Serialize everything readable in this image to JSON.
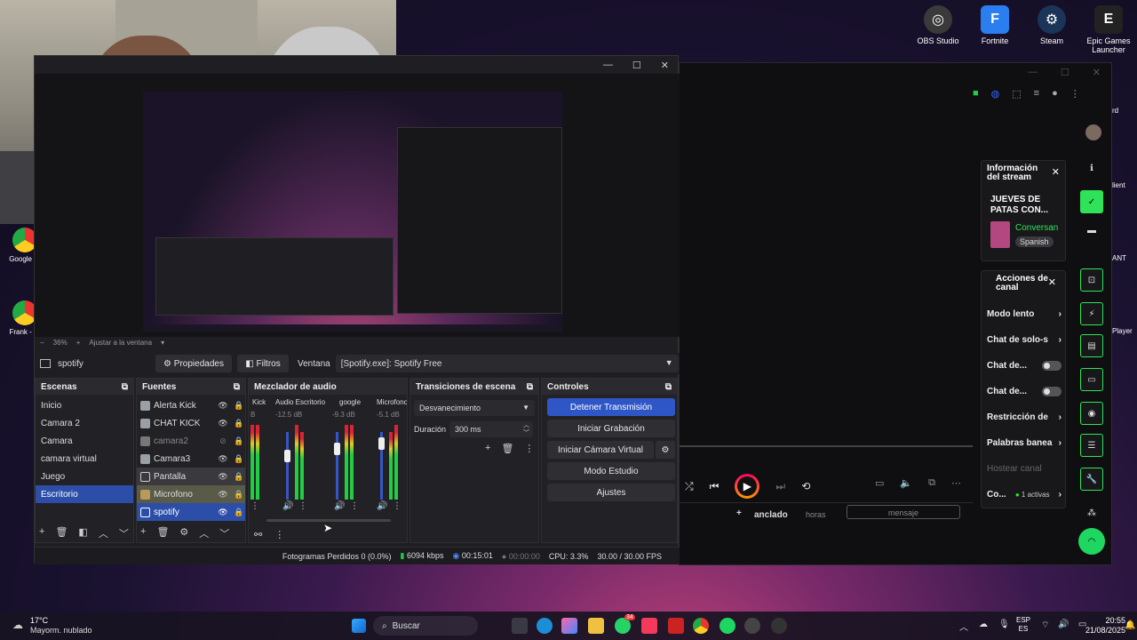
{
  "desktop_icons": [
    {
      "label": "OBS Studio",
      "color": "#3a3a3a"
    },
    {
      "label": "Fortnite",
      "color": "#2a7ef0"
    },
    {
      "label": "Steam",
      "color": "#1b3558"
    },
    {
      "label": "Epic Games Launcher",
      "color": "#222222"
    }
  ],
  "left_icons": [
    {
      "label": "Google Cl"
    },
    {
      "label": "Frank - Cl"
    }
  ],
  "right_edge_labels": [
    "lient",
    "ANT",
    "Player",
    "rd"
  ],
  "obs": {
    "preview_zoom": "36%",
    "fit_label": "Ajustar a la ventana",
    "source_bar": {
      "name": "spotify",
      "properties": "Propiedades",
      "filters": "Filtros",
      "window_label": "Ventana",
      "window_value": "[Spotify.exe]: Spotify Free"
    },
    "scenes": {
      "title": "Escenas",
      "items": [
        "Inicio",
        "Camara 2",
        "Camara",
        "camara virtual",
        "Juego",
        "Escritorio"
      ],
      "selected": 5
    },
    "sources": {
      "title": "Fuentes",
      "items": [
        {
          "label": "Alerta Kick",
          "color": "#9aa0a6"
        },
        {
          "label": "CHAT KICK",
          "color": "#9aa0a6"
        },
        {
          "label": "camara2",
          "color": "#777777"
        },
        {
          "label": "Camara3",
          "color": "#9aa0a6"
        },
        {
          "label": "Pantalla",
          "color": "#9aa0a6"
        },
        {
          "label": "Microfono",
          "color": "#b89a5a"
        },
        {
          "label": "spotify",
          "color": "#9aa0a6"
        }
      ]
    },
    "mixer": {
      "title": "Mezclador de audio",
      "channels": [
        {
          "name": "Kick",
          "db": "B"
        },
        {
          "name": "Audio Escritorio",
          "db": "-12.5 dB"
        },
        {
          "name": "google",
          "db": "-9.3 dB"
        },
        {
          "name": "Microfono",
          "db": "-5.1 dB"
        }
      ],
      "scale": [
        "5",
        "0",
        "-5",
        "-10",
        "-15",
        "-20",
        "-25",
        "-30",
        "-35",
        "-40",
        "-45",
        "-50",
        "-55",
        "-60"
      ]
    },
    "transitions": {
      "title": "Transiciones de escena",
      "selected": "Desvanecimiento",
      "duration_label": "Duración",
      "duration_value": "300 ms"
    },
    "controls": {
      "title": "Controles",
      "stop_stream": "Detener Transmisión",
      "start_recording": "Iniciar Grabación",
      "start_virtual_cam": "Iniciar Cámara Virtual",
      "studio_mode": "Modo Estudio",
      "settings": "Ajustes"
    },
    "status": {
      "dropped": "Fotogramas Perdidos 0 (0.0%)",
      "bitrate": "6094 kbps",
      "stream_time": "00:15:01",
      "rec_time": "00:00:00",
      "cpu": "CPU: 3.3%",
      "fps": "30.00 / 30.00 FPS"
    }
  },
  "stream_info": {
    "title": "Información del stream",
    "stream_title": "JUEVES DE PATAS CON...",
    "category": "Conversan",
    "language": "Spanish"
  },
  "channel_actions": {
    "title": "Acciones de canal",
    "items": [
      {
        "label": "Modo lento",
        "kind": "arrow"
      },
      {
        "label": "Chat de solo-s",
        "kind": "arrow"
      },
      {
        "label": "Chat de...",
        "kind": "toggle"
      },
      {
        "label": "Chat de...",
        "kind": "toggle"
      },
      {
        "label": "Restricción de",
        "kind": "arrow"
      },
      {
        "label": "Palabras banea",
        "kind": "arrow"
      }
    ],
    "host": "Hostear canal",
    "co": "Co...",
    "co_active": "1 activas"
  },
  "player": {
    "pinned": "anclado",
    "hours": "horas",
    "message": "mensaje"
  },
  "taskbar": {
    "weather_temp": "17°C",
    "weather_desc": "Mayorm. nublado",
    "search": "Buscar",
    "badge": "34",
    "lang1": "ESP",
    "lang2": "ES",
    "time": "20:55",
    "date": "21/08/2025"
  }
}
